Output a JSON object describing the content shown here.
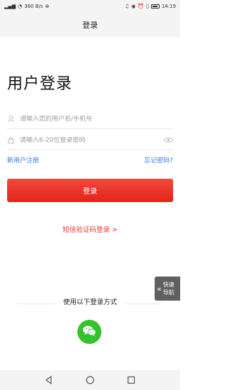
{
  "status_bar": {
    "left_indicators": "4G 4G",
    "speed": "360 B/s",
    "right_indicators": "",
    "time": "14:19"
  },
  "nav": {
    "title": "登录"
  },
  "page": {
    "heading": "用户登录"
  },
  "form": {
    "username_placeholder": "请输入您的用户名/手机号",
    "password_placeholder": "请输入6-20位登录密码"
  },
  "links": {
    "register": "新用户注册",
    "forgot": "忘记密码?"
  },
  "login_button": "登录",
  "sms_login": "短信验证码登录 >",
  "quick_nav": {
    "line1": "快速",
    "line2": "导航"
  },
  "other_login": "使用以下登录方式",
  "icons": {
    "username": "user-icon",
    "password": "lock-icon",
    "show_password": "eye-icon",
    "wechat": "wechat-icon",
    "back": "triangle-back-icon",
    "home": "circle-home-icon",
    "recent": "square-recent-icon"
  },
  "colors": {
    "primary_red": "#e4231b",
    "link_blue": "#3b78d8",
    "wechat_green": "#38c12e"
  }
}
